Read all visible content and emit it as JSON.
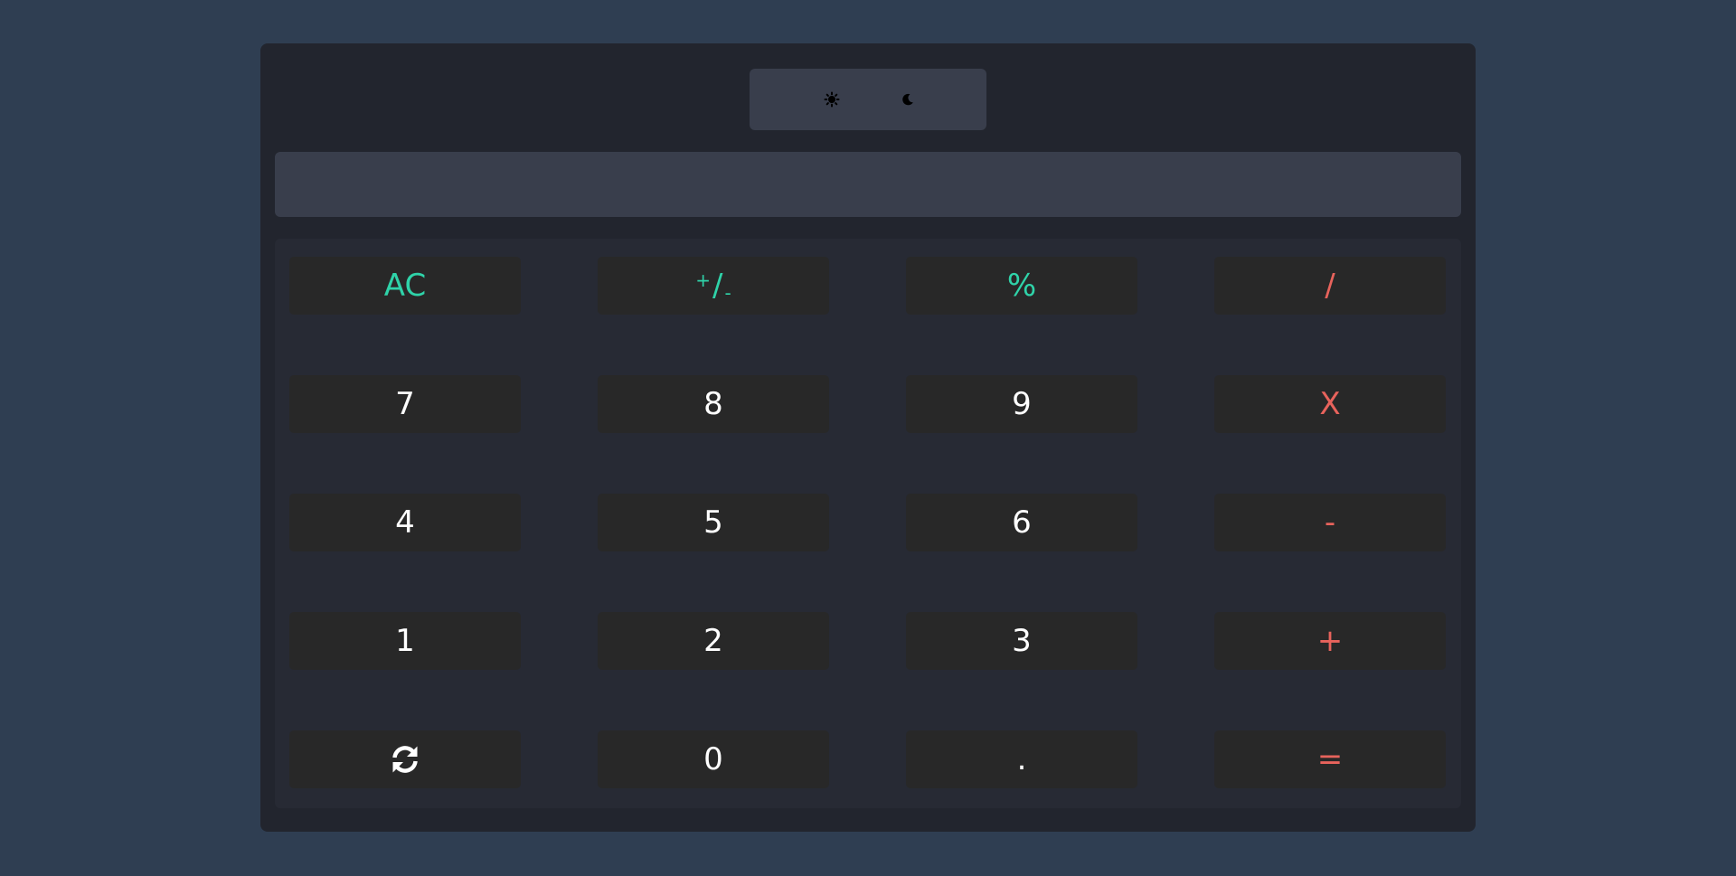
{
  "theme_toggle": {
    "light_icon": "sun-icon",
    "dark_icon": "moon-icon"
  },
  "display": {
    "value": ""
  },
  "keys": {
    "clear": "AC",
    "sign_sup": "+",
    "sign_slash": "/",
    "sign_sub": "-",
    "percent": "%",
    "divide": "/",
    "seven": "7",
    "eight": "8",
    "nine": "9",
    "multiply": "X",
    "four": "4",
    "five": "5",
    "six": "6",
    "subtract": "-",
    "one": "1",
    "two": "2",
    "three": "3",
    "add": "+",
    "refresh_icon": "refresh-icon",
    "zero": "0",
    "decimal": ".",
    "equals": "="
  },
  "colors": {
    "background": "#2f3e52",
    "panel": "#22252e",
    "display": "#393e4c",
    "keypad": "#272a34",
    "key": "#282828",
    "accent_green": "#2fd3a9",
    "accent_red": "#e8635c"
  }
}
